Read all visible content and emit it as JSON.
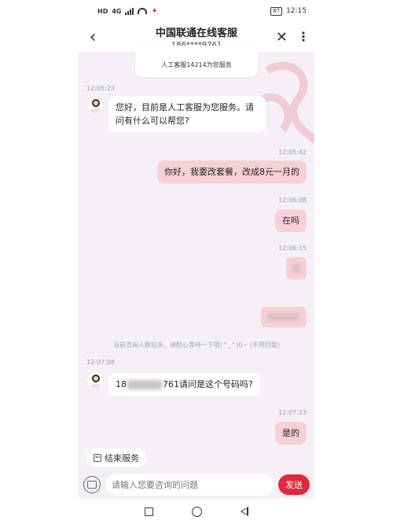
{
  "status_bar": {
    "network": "HD",
    "network_gen": "4G",
    "battery": "87",
    "time": "12:15"
  },
  "header": {
    "title": "中国联通在线客服",
    "subtitle": "186****9761",
    "info": "人工客服14214为您服务"
  },
  "messages": [
    {
      "time": "12:05:23",
      "text": "您好，目前是人工客服为您服务。请问有什么可以帮您?"
    },
    {
      "time": "12:05:42",
      "text": "你好，我要改套餐，改成8元一月的"
    },
    {
      "time": "12:06:08",
      "text": "在吗"
    },
    {
      "time": "12:06:15"
    },
    {
      "notice": "当前咨询人数较多，请耐心等待一下哦(^_^)0~ (不用回复)"
    },
    {
      "time": "12:07:08",
      "text_prefix": "18",
      "text_suffix": "761请问是这个号码吗?"
    },
    {
      "time": "12:07:23",
      "text": "是的"
    }
  ],
  "footer": {
    "end_service": "结束服务",
    "input_placeholder": "请输入您要咨询的问题",
    "send": "发送"
  },
  "colors": {
    "accent": "#e0293b",
    "user_bubble": "#f7d0d6",
    "background": "#f4f0f6"
  }
}
